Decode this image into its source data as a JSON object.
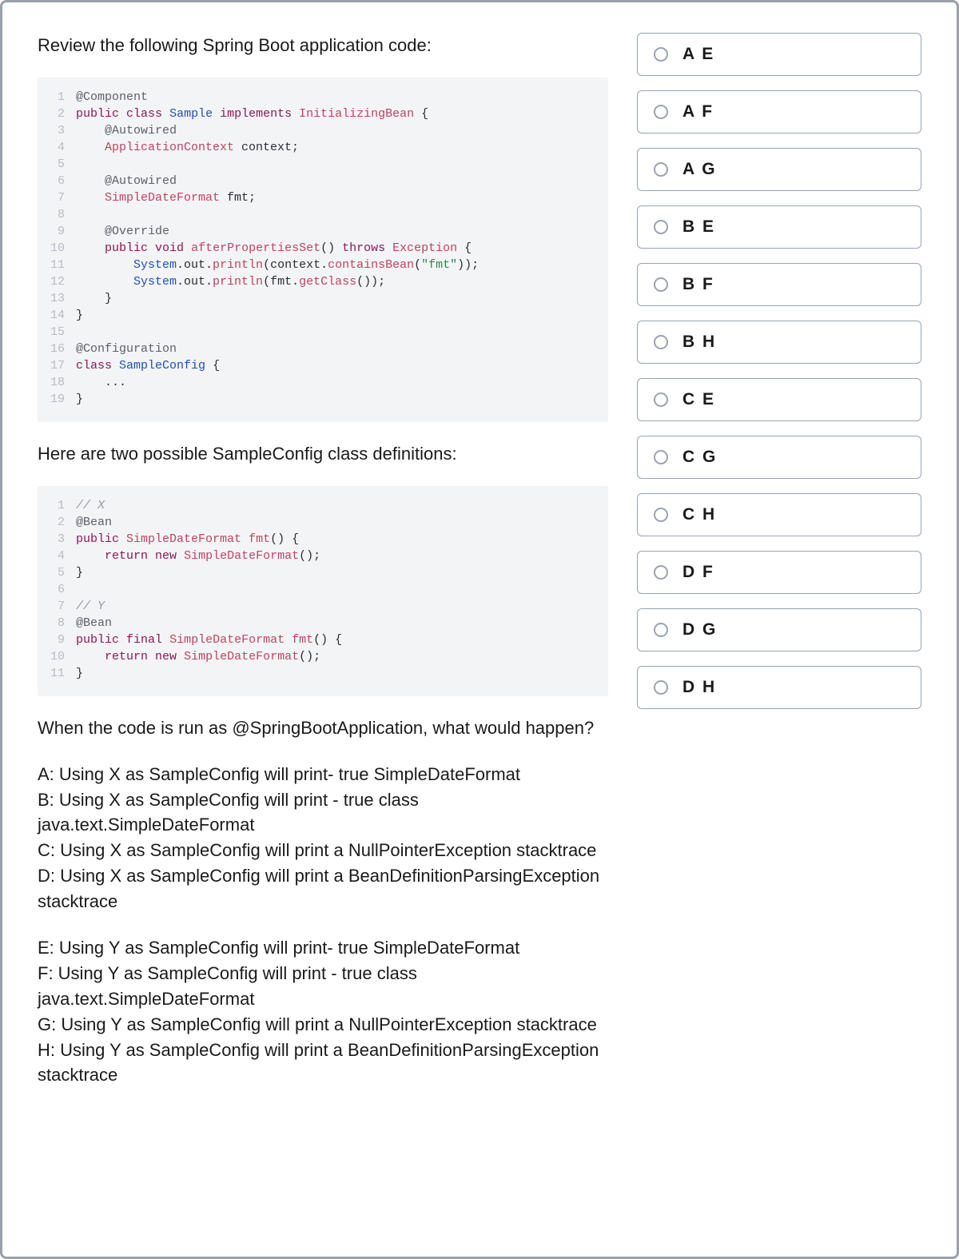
{
  "question": {
    "intro": "Review the following Spring Boot application code:",
    "mid": "Here are two possible SampleConfig class definitions:",
    "prompt": "When the code is run as @SpringBootApplication, what would happen?",
    "optionsX": [
      "A: Using X as SampleConfig will print- true SimpleDateFormat",
      "B: Using X as SampleConfig will print - true class java.text.SimpleDateFormat",
      "C: Using X as SampleConfig will print a NullPointerException stacktrace",
      "D: Using X as SampleConfig will print a BeanDefinitionParsingException stacktrace"
    ],
    "optionsY": [
      "E: Using Y as SampleConfig will print- true SimpleDateFormat",
      "F: Using Y as SampleConfig will print - true class java.text.SimpleDateFormat",
      "G: Using Y as SampleConfig will print a NullPointerException stacktrace",
      "H: Using Y as SampleConfig will print a BeanDefinitionParsingException stacktrace"
    ]
  },
  "code1": [
    [
      {
        "c": "tok-annotation",
        "t": "@Component"
      }
    ],
    [
      {
        "c": "tok-keyword",
        "t": "public"
      },
      {
        "c": "tok-plain",
        "t": " "
      },
      {
        "c": "tok-keyword",
        "t": "class"
      },
      {
        "c": "tok-plain",
        "t": " "
      },
      {
        "c": "tok-type",
        "t": "Sample"
      },
      {
        "c": "tok-plain",
        "t": " "
      },
      {
        "c": "tok-keyword",
        "t": "implements"
      },
      {
        "c": "tok-plain",
        "t": " "
      },
      {
        "c": "tok-method",
        "t": "InitializingBean"
      },
      {
        "c": "tok-plain",
        "t": " {"
      }
    ],
    [
      {
        "c": "tok-plain",
        "t": "    "
      },
      {
        "c": "tok-annotation",
        "t": "@Autowired"
      }
    ],
    [
      {
        "c": "tok-plain",
        "t": "    "
      },
      {
        "c": "tok-method",
        "t": "ApplicationContext"
      },
      {
        "c": "tok-plain",
        "t": " context;"
      }
    ],
    [
      {
        "c": "tok-plain",
        "t": ""
      }
    ],
    [
      {
        "c": "tok-plain",
        "t": "    "
      },
      {
        "c": "tok-annotation",
        "t": "@Autowired"
      }
    ],
    [
      {
        "c": "tok-plain",
        "t": "    "
      },
      {
        "c": "tok-method",
        "t": "SimpleDateFormat"
      },
      {
        "c": "tok-plain",
        "t": " fmt;"
      }
    ],
    [
      {
        "c": "tok-plain",
        "t": ""
      }
    ],
    [
      {
        "c": "tok-plain",
        "t": "    "
      },
      {
        "c": "tok-annotation",
        "t": "@Override"
      }
    ],
    [
      {
        "c": "tok-plain",
        "t": "    "
      },
      {
        "c": "tok-keyword",
        "t": "public"
      },
      {
        "c": "tok-plain",
        "t": " "
      },
      {
        "c": "tok-keyword",
        "t": "void"
      },
      {
        "c": "tok-plain",
        "t": " "
      },
      {
        "c": "tok-method",
        "t": "afterPropertiesSet"
      },
      {
        "c": "tok-plain",
        "t": "() "
      },
      {
        "c": "tok-keyword",
        "t": "throws"
      },
      {
        "c": "tok-plain",
        "t": " "
      },
      {
        "c": "tok-method",
        "t": "Exception"
      },
      {
        "c": "tok-plain",
        "t": " {"
      }
    ],
    [
      {
        "c": "tok-plain",
        "t": "        "
      },
      {
        "c": "tok-type",
        "t": "System"
      },
      {
        "c": "tok-plain",
        "t": ".out."
      },
      {
        "c": "tok-method",
        "t": "println"
      },
      {
        "c": "tok-plain",
        "t": "(context."
      },
      {
        "c": "tok-method",
        "t": "containsBean"
      },
      {
        "c": "tok-plain",
        "t": "("
      },
      {
        "c": "tok-string",
        "t": "\"fmt\""
      },
      {
        "c": "tok-plain",
        "t": "));"
      }
    ],
    [
      {
        "c": "tok-plain",
        "t": "        "
      },
      {
        "c": "tok-type",
        "t": "System"
      },
      {
        "c": "tok-plain",
        "t": ".out."
      },
      {
        "c": "tok-method",
        "t": "println"
      },
      {
        "c": "tok-plain",
        "t": "(fmt."
      },
      {
        "c": "tok-method",
        "t": "getClass"
      },
      {
        "c": "tok-plain",
        "t": "());"
      }
    ],
    [
      {
        "c": "tok-plain",
        "t": "    }"
      }
    ],
    [
      {
        "c": "tok-plain",
        "t": "}"
      }
    ],
    [
      {
        "c": "tok-plain",
        "t": ""
      }
    ],
    [
      {
        "c": "tok-annotation",
        "t": "@Configuration"
      }
    ],
    [
      {
        "c": "tok-keyword",
        "t": "class"
      },
      {
        "c": "tok-plain",
        "t": " "
      },
      {
        "c": "tok-type",
        "t": "SampleConfig"
      },
      {
        "c": "tok-plain",
        "t": " {"
      }
    ],
    [
      {
        "c": "tok-plain",
        "t": "    ..."
      }
    ],
    [
      {
        "c": "tok-plain",
        "t": "}"
      }
    ]
  ],
  "code2": [
    [
      {
        "c": "tok-comment",
        "t": "// X"
      }
    ],
    [
      {
        "c": "tok-annotation",
        "t": "@Bean"
      }
    ],
    [
      {
        "c": "tok-keyword",
        "t": "public"
      },
      {
        "c": "tok-plain",
        "t": " "
      },
      {
        "c": "tok-method",
        "t": "SimpleDateFormat"
      },
      {
        "c": "tok-plain",
        "t": " "
      },
      {
        "c": "tok-method",
        "t": "fmt"
      },
      {
        "c": "tok-plain",
        "t": "() {"
      }
    ],
    [
      {
        "c": "tok-plain",
        "t": "    "
      },
      {
        "c": "tok-keyword",
        "t": "return"
      },
      {
        "c": "tok-plain",
        "t": " "
      },
      {
        "c": "tok-keyword",
        "t": "new"
      },
      {
        "c": "tok-plain",
        "t": " "
      },
      {
        "c": "tok-method",
        "t": "SimpleDateFormat"
      },
      {
        "c": "tok-plain",
        "t": "();"
      }
    ],
    [
      {
        "c": "tok-plain",
        "t": "}"
      }
    ],
    [
      {
        "c": "tok-plain",
        "t": ""
      }
    ],
    [
      {
        "c": "tok-comment",
        "t": "// Y"
      }
    ],
    [
      {
        "c": "tok-annotation",
        "t": "@Bean"
      }
    ],
    [
      {
        "c": "tok-keyword",
        "t": "public"
      },
      {
        "c": "tok-plain",
        "t": " "
      },
      {
        "c": "tok-keyword",
        "t": "final"
      },
      {
        "c": "tok-plain",
        "t": " "
      },
      {
        "c": "tok-method",
        "t": "SimpleDateFormat"
      },
      {
        "c": "tok-plain",
        "t": " "
      },
      {
        "c": "tok-method",
        "t": "fmt"
      },
      {
        "c": "tok-plain",
        "t": "() {"
      }
    ],
    [
      {
        "c": "tok-plain",
        "t": "    "
      },
      {
        "c": "tok-keyword",
        "t": "return"
      },
      {
        "c": "tok-plain",
        "t": " "
      },
      {
        "c": "tok-keyword",
        "t": "new"
      },
      {
        "c": "tok-plain",
        "t": " "
      },
      {
        "c": "tok-method",
        "t": "SimpleDateFormat"
      },
      {
        "c": "tok-plain",
        "t": "();"
      }
    ],
    [
      {
        "c": "tok-plain",
        "t": "}"
      }
    ]
  ],
  "choices": [
    "A E",
    "A F",
    "A G",
    "B E",
    "B F",
    "B H",
    "C E",
    "C G",
    "C H",
    "D F",
    "D G",
    "D H"
  ]
}
